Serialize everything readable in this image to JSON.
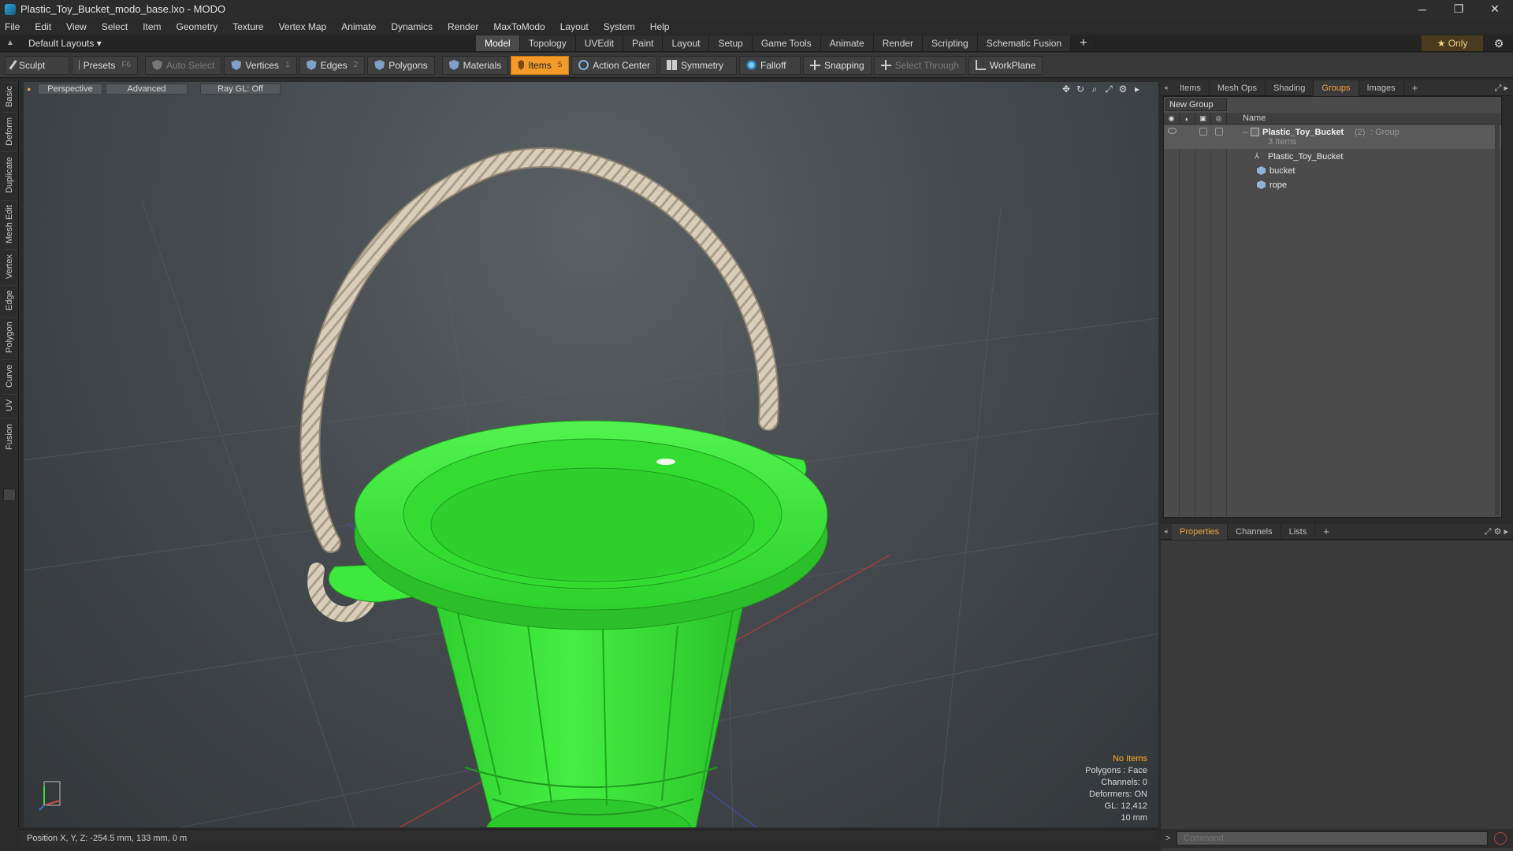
{
  "window": {
    "title": "Plastic_Toy_Bucket_modo_base.lxo - MODO",
    "minimize": "─",
    "maximize": "❐",
    "close": "✕"
  },
  "menu": [
    "File",
    "Edit",
    "View",
    "Select",
    "Item",
    "Geometry",
    "Texture",
    "Vertex Map",
    "Animate",
    "Dynamics",
    "Render",
    "MaxToModo",
    "Layout",
    "System",
    "Help"
  ],
  "layout": {
    "selector": "Default Layouts ▾",
    "tabs": [
      "Model",
      "Topology",
      "UVEdit",
      "Paint",
      "Layout",
      "Setup",
      "Game Tools",
      "Animate",
      "Render",
      "Scripting",
      "Schematic Fusion"
    ],
    "active_tab": "Model",
    "only": "★ Only"
  },
  "toolbar": {
    "sculpt": "Sculpt",
    "presets": "Presets",
    "presets_key": "F6",
    "auto_select": "Auto Select",
    "vertices": "Vertices",
    "vertices_key": "1",
    "edges": "Edges",
    "edges_key": "2",
    "polygons": "Polygons",
    "materials": "Materials",
    "items": "Items",
    "items_key": "5",
    "action_center": "Action Center",
    "symmetry": "Symmetry",
    "falloff": "Falloff",
    "snapping": "Snapping",
    "select_through": "Select Through",
    "workplane": "WorkPlane"
  },
  "left_tabs": [
    "Basic",
    "Deform",
    "Duplicate",
    "Mesh Edit",
    "Vertex",
    "Edge",
    "Polygon",
    "Curve",
    "UV",
    "Fusion"
  ],
  "viewport": {
    "view_mode": "Perspective",
    "shading": "Advanced",
    "raygl": "Ray GL: Off",
    "info": {
      "selection": "No Items",
      "polygons": "Polygons : Face",
      "channels": "Channels: 0",
      "deformers": "Deformers: ON",
      "gl": "GL: 12,412",
      "grid": "10 mm"
    },
    "colors": {
      "bucket": "#3ee83c",
      "bucket_shadow": "#22b424",
      "rope": "#d6cbb6",
      "warn": "#ffb020"
    }
  },
  "status": {
    "position": "Position X, Y, Z:  -254.5 mm, 133 mm, 0 m"
  },
  "top_panel": {
    "tabs": [
      "Items",
      "Mesh Ops",
      "Shading",
      "Groups",
      "Images"
    ],
    "active_tab": "Groups",
    "plus": "+",
    "new_group": "New Group",
    "column_name": "Name",
    "tree": {
      "group_name": "Plastic_Toy_Bucket",
      "group_count": "(2)",
      "group_type": ": Group",
      "items_count": "3 Items",
      "children": [
        "Plastic_Toy_Bucket",
        "bucket",
        "rope"
      ]
    }
  },
  "bottom_panel": {
    "tabs": [
      "Properties",
      "Channels",
      "Lists"
    ],
    "active_tab": "Properties",
    "plus": "+"
  },
  "command": {
    "prompt": ">",
    "placeholder": "Command"
  }
}
